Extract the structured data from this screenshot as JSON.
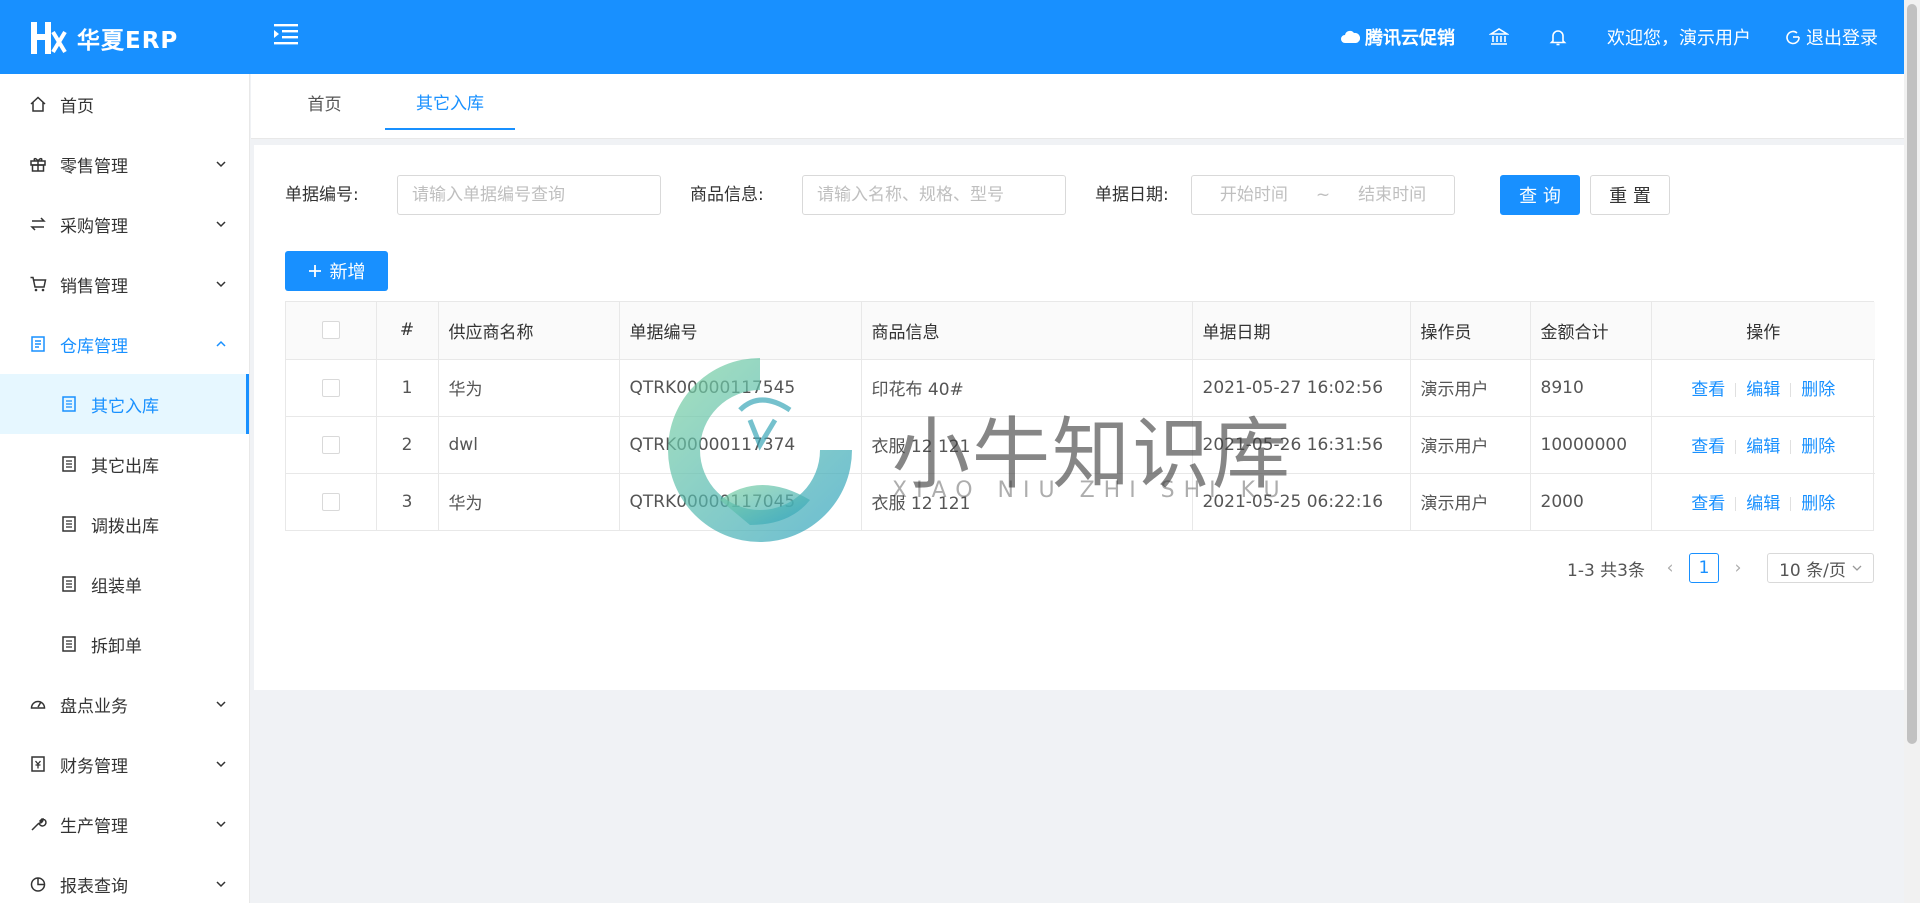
{
  "app": {
    "logo_text": "华夏ERP"
  },
  "header": {
    "promo": "腾讯云促销",
    "welcome": "欢迎您，演示用户",
    "logout": "退出登录"
  },
  "sidebar": {
    "items": [
      {
        "label": "首页",
        "icon": "home-icon"
      },
      {
        "label": "零售管理",
        "icon": "gift-icon"
      },
      {
        "label": "采购管理",
        "icon": "swap-icon"
      },
      {
        "label": "销售管理",
        "icon": "cart-icon"
      },
      {
        "label": "仓库管理",
        "icon": "warehouse-icon"
      },
      {
        "label": "其它入库",
        "icon": "document-icon"
      },
      {
        "label": "其它出库",
        "icon": "document-icon"
      },
      {
        "label": "调拨出库",
        "icon": "document-icon"
      },
      {
        "label": "组装单",
        "icon": "document-icon"
      },
      {
        "label": "拆卸单",
        "icon": "document-icon"
      },
      {
        "label": "盘点业务",
        "icon": "dashboard-icon"
      },
      {
        "label": "财务管理",
        "icon": "account-book-icon"
      },
      {
        "label": "生产管理",
        "icon": "tool-icon"
      },
      {
        "label": "报表查询",
        "icon": "pie-chart-icon"
      }
    ]
  },
  "tabs": [
    {
      "label": "首页"
    },
    {
      "label": "其它入库"
    }
  ],
  "query": {
    "bill_no_label": "单据编号:",
    "bill_no_placeholder": "请输入单据编号查询",
    "goods_label": "商品信息:",
    "goods_placeholder": "请输入名称、规格、型号",
    "date_label": "单据日期:",
    "date_start": "开始时间",
    "date_sep": "~",
    "date_end": "结束时间",
    "search_btn": "查 询",
    "reset_btn": "重 置"
  },
  "add_btn": "新增",
  "table": {
    "headers": [
      "#",
      "供应商名称",
      "单据编号",
      "商品信息",
      "单据日期",
      "操作员",
      "金额合计",
      "操作"
    ],
    "rows": [
      {
        "idx": "1",
        "supplier": "华为",
        "bill_no": "QTRK00000117545",
        "goods": "印花布 40#",
        "date": "2021-05-27 16:02:56",
        "operator": "演示用户",
        "amount": "8910"
      },
      {
        "idx": "2",
        "supplier": "dwl",
        "bill_no": "QTRK00000117374",
        "goods": "衣服 12 121",
        "date": "2021-05-26 16:31:56",
        "operator": "演示用户",
        "amount": "10000000"
      },
      {
        "idx": "3",
        "supplier": "华为",
        "bill_no": "QTRK00000117045",
        "goods": "衣服 12 121",
        "date": "2021-05-25 06:22:16",
        "operator": "演示用户",
        "amount": "2000"
      }
    ],
    "actions": {
      "view": "查看",
      "edit": "编辑",
      "delete": "删除"
    }
  },
  "pagination": {
    "summary": "1-3 共3条",
    "current": "1",
    "page_size": "10 条/页"
  },
  "watermark": {
    "title": "小牛知识库",
    "subtitle": "XIAO NIU ZHI SHI KU"
  },
  "colors": {
    "primary": "#1890ff",
    "selected_bg": "#e6f7ff",
    "page_bg": "#f0f2f5"
  }
}
